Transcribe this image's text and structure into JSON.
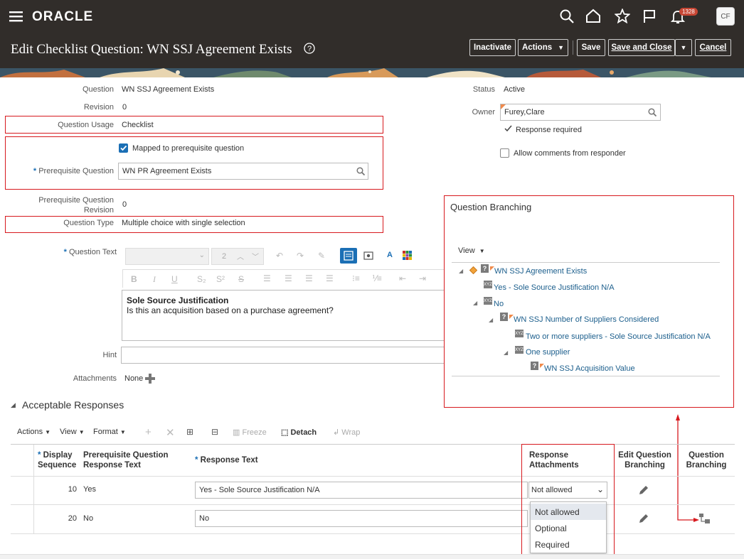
{
  "app": {
    "logo": "ORACLE",
    "notification_count": "1328",
    "user_initials": "CF",
    "page_title": "Edit Checklist Question: WN SSJ Agreement Exists",
    "buttons": {
      "inactivate": "Inactivate",
      "actions": "Actions",
      "save": "Save",
      "save_and_close": "Save and Close",
      "cancel": "Cancel"
    }
  },
  "form": {
    "question_label": "Question",
    "question_value": "WN SSJ Agreement Exists",
    "revision_label": "Revision",
    "revision_value": "0",
    "usage_label": "Question Usage",
    "usage_value": "Checklist",
    "mapped_label": "Mapped to prerequisite question",
    "prereq_label": "Prerequisite Question",
    "prereq_value": "WN PR Agreement Exists",
    "prereq_rev_label_1": "Prerequisite Question",
    "prereq_rev_label_2": "Revision",
    "prereq_rev_value": "0",
    "type_label": "Question Type",
    "type_value": "Multiple choice with single selection",
    "qtext_label": "Question Text",
    "font_size": "2",
    "qtext_line1": "Sole Source Justification",
    "qtext_line2": "Is this an acquisition based on a purchase agreement?",
    "hint_label": "Hint",
    "attachments_label": "Attachments",
    "attachments_value": "None",
    "status_label": "Status",
    "status_value": "Active",
    "owner_label": "Owner",
    "owner_value": "Furey,Clare",
    "response_required": "Response required",
    "allow_comments": "Allow comments from responder"
  },
  "branching": {
    "title": "Question Branching",
    "view_label": "View",
    "nodes": [
      "WN SSJ Agreement Exists",
      "Yes - Sole Source Justification N/A",
      "No",
      "WN SSJ Number of Suppliers Considered",
      "Two or more suppliers - Sole Source Justification N/A",
      "One supplier",
      "WN SSJ Acquisition Value"
    ]
  },
  "responses": {
    "section_title": "Acceptable Responses",
    "toolbar": {
      "actions": "Actions",
      "view": "View",
      "format": "Format",
      "freeze": "Freeze",
      "detach": "Detach",
      "wrap": "Wrap"
    },
    "columns": {
      "display": "Display",
      "sequence": "Sequence",
      "prereq_1": "Prerequisite Question",
      "prereq_2": "Response Text",
      "response_text": "Response Text",
      "attach_1": "Response",
      "attach_2": "Attachments",
      "edit_1": "Edit Question",
      "edit_2": "Branching",
      "branch_1": "Question",
      "branch_2": "Branching"
    },
    "rows": [
      {
        "sequence": "10",
        "prereq": "Yes",
        "text": "Yes - Sole Source Justification N/A",
        "attachments": "Not allowed"
      },
      {
        "sequence": "20",
        "prereq": "No",
        "text": "No",
        "attachments": ""
      }
    ],
    "dropdown_options": [
      "Not allowed",
      "Optional",
      "Required"
    ]
  },
  "colors": {
    "header_bg": "#312d2a",
    "callout_red": "#d7191e",
    "link_blue": "#1b5e8c",
    "accent_blue": "#1b6fb5"
  }
}
